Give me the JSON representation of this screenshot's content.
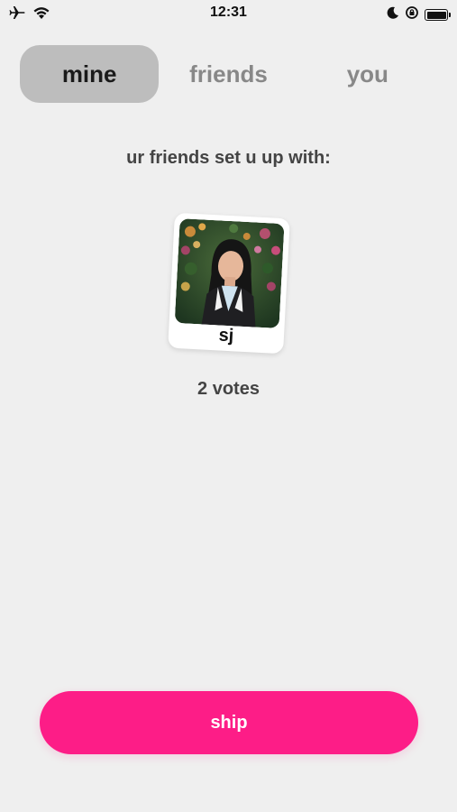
{
  "status_bar": {
    "time": "12:31",
    "icons_left": [
      "airplane-icon",
      "wifi-icon"
    ],
    "icons_right": [
      "moon-icon",
      "orientation-lock-icon",
      "battery-icon"
    ]
  },
  "tabs": [
    {
      "label": "mine",
      "active": true
    },
    {
      "label": "friends",
      "active": false
    },
    {
      "label": "you",
      "active": false
    }
  ],
  "main": {
    "headline": "ur friends set u up with:",
    "match": {
      "name": "sj",
      "photo_icon": "profile-photo"
    },
    "votes": "2 votes"
  },
  "ship_button": {
    "label": "ship"
  },
  "colors": {
    "background": "#efefef",
    "active_tab": "#bdbdbd",
    "inactive_tab_text": "#888888",
    "accent": "#fd1d87"
  }
}
